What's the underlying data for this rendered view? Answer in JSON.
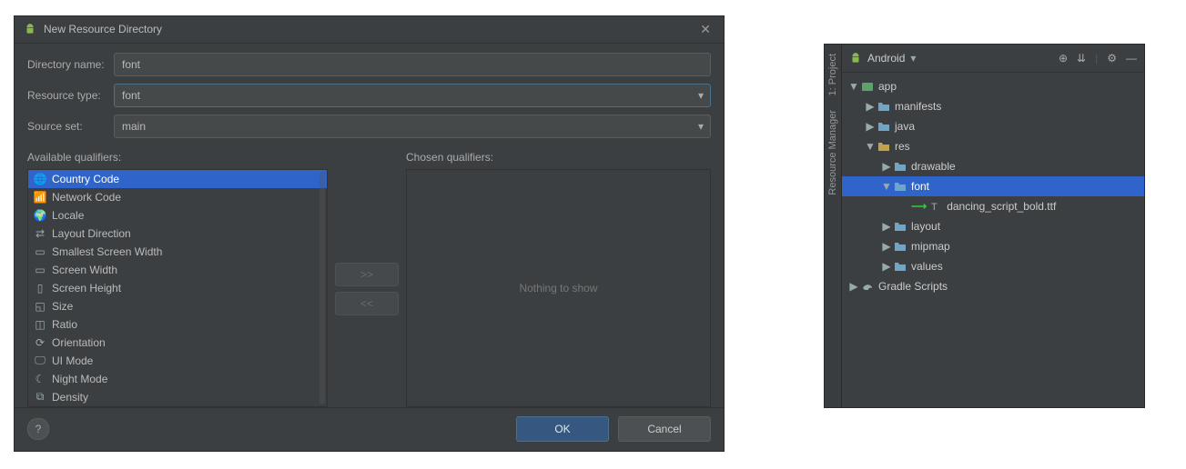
{
  "dialog": {
    "title": "New Resource Directory",
    "labels": {
      "dir_name": "Directory name:",
      "res_type": "Resource type:",
      "source_set": "Source set:",
      "avail": "Available qualifiers:",
      "chosen": "Chosen qualifiers:"
    },
    "values": {
      "dir_name": "font",
      "res_type": "font",
      "source_set": "main"
    },
    "chosen_empty": "Nothing to show",
    "move_right": ">>",
    "move_left": "<<",
    "available": [
      {
        "label": "Country Code",
        "icon": "globe",
        "selected": true
      },
      {
        "label": "Network Code",
        "icon": "network"
      },
      {
        "label": "Locale",
        "icon": "globe-o"
      },
      {
        "label": "Layout Direction",
        "icon": "layout"
      },
      {
        "label": "Smallest Screen Width",
        "icon": "sw"
      },
      {
        "label": "Screen Width",
        "icon": "w"
      },
      {
        "label": "Screen Height",
        "icon": "h"
      },
      {
        "label": "Size",
        "icon": "size"
      },
      {
        "label": "Ratio",
        "icon": "ratio"
      },
      {
        "label": "Orientation",
        "icon": "orient"
      },
      {
        "label": "UI Mode",
        "icon": "ui"
      },
      {
        "label": "Night Mode",
        "icon": "night"
      },
      {
        "label": "Density",
        "icon": "density"
      }
    ],
    "buttons": {
      "help": "?",
      "ok": "OK",
      "cancel": "Cancel"
    }
  },
  "panel": {
    "gutter": {
      "top": "1: Project",
      "bottom": "Resource Manager"
    },
    "header": {
      "title": "Android"
    },
    "tree": [
      {
        "depth": 0,
        "expand": "down",
        "icon": "module",
        "cls": "app",
        "label": "app",
        "sel": false
      },
      {
        "depth": 1,
        "expand": "right",
        "icon": "folder",
        "cls": "folder",
        "label": "manifests",
        "sel": false
      },
      {
        "depth": 1,
        "expand": "right",
        "icon": "folder",
        "cls": "folder",
        "label": "java",
        "sel": false
      },
      {
        "depth": 1,
        "expand": "down",
        "icon": "folder",
        "cls": "gold",
        "label": "res",
        "sel": false
      },
      {
        "depth": 2,
        "expand": "right",
        "icon": "folder",
        "cls": "folder",
        "label": "drawable",
        "sel": false
      },
      {
        "depth": 2,
        "expand": "down",
        "icon": "folder",
        "cls": "folder",
        "label": "font",
        "sel": true
      },
      {
        "depth": 3,
        "expand": "",
        "icon": "font",
        "cls": "",
        "label": "dancing_script_bold.ttf",
        "sel": false,
        "annot": true
      },
      {
        "depth": 2,
        "expand": "right",
        "icon": "folder",
        "cls": "folder",
        "label": "layout",
        "sel": false
      },
      {
        "depth": 2,
        "expand": "right",
        "icon": "folder",
        "cls": "folder",
        "label": "mipmap",
        "sel": false
      },
      {
        "depth": 2,
        "expand": "right",
        "icon": "folder",
        "cls": "folder",
        "label": "values",
        "sel": false
      },
      {
        "depth": 0,
        "expand": "right",
        "icon": "gradle",
        "cls": "",
        "label": "Gradle Scripts",
        "sel": false
      }
    ]
  }
}
